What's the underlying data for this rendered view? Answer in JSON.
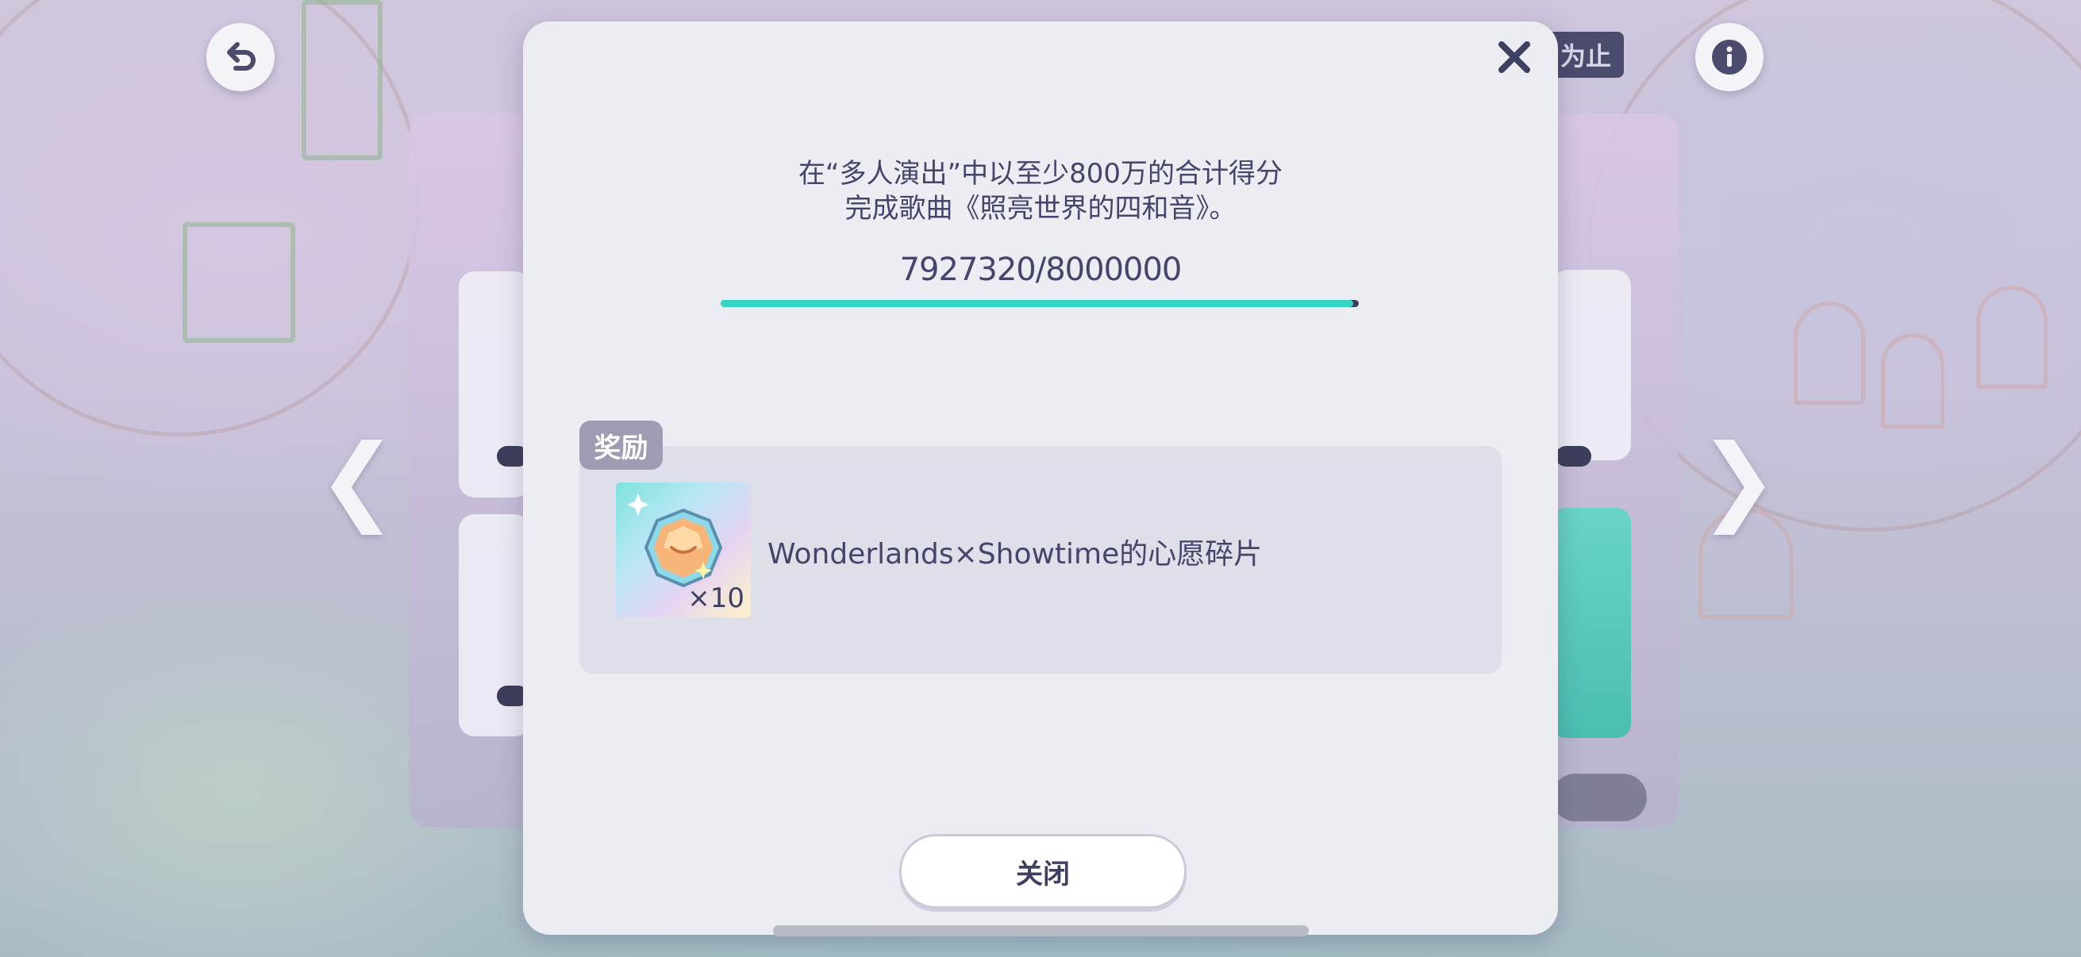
{
  "dialog": {
    "mission_line1": "在“多人演出”中以至少800万的合计得分",
    "mission_line2": "完成歌曲《照亮世界的四和音》。",
    "progress_text": "7927320/8000000",
    "progress": {
      "current": 7927320,
      "target": 8000000
    },
    "reward_tag": "奖励",
    "reward": {
      "name": "Wonderlands×Showtime的心愿碎片",
      "count": "×10",
      "icon": "wish-shard-icon"
    },
    "close_button": "关闭"
  },
  "background": {
    "top_right_tag": "为止"
  },
  "colors": {
    "accent": "#35d6c6",
    "text": "#43456a",
    "modal_bg": "#ecedf3",
    "reward_bg": "#dfdfea"
  }
}
